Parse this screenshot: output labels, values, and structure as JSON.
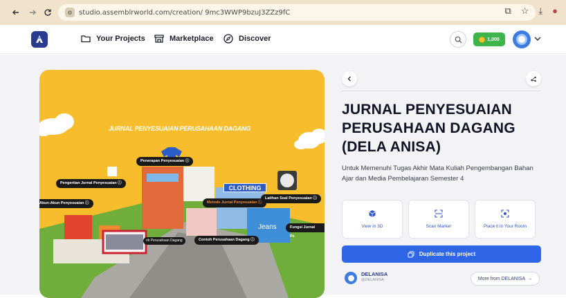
{
  "browser": {
    "url": "studio.assemblrworld.com/creation/ 9mc3WWP9bzuJ3ZZz9fC",
    "back_icon": "arrow-left-icon",
    "forward_icon": "arrow-right-icon",
    "reload_icon": "reload-icon"
  },
  "header": {
    "nav": [
      {
        "label": "Your Projects",
        "icon": "folder-icon"
      },
      {
        "label": "Marketplace",
        "icon": "store-icon"
      },
      {
        "label": "Discover",
        "icon": "compass-icon"
      }
    ],
    "coins": "1,000"
  },
  "scene": {
    "heading": "JURNAL PENYESUAIAN PERUSAHAAN DAGANG",
    "store_sign": "CLOTHING",
    "jeans_sign": "Jeans",
    "labels": [
      "Penerapan Penyesuaian",
      "Pengertian Jurnal Penyesuaian",
      "Akun-Akun Penyesuaian",
      "Metode Jurnal Penyesuaian",
      "Latihan Soal Penyesuaian",
      "Fungsi Jurnal Pe",
      "Contoh Perusahaan Dagang",
      "rik Perusahaan Dagang"
    ]
  },
  "panel": {
    "title": "JURNAL PENYESUAIAN PERUSAHAAN DAGANG (DELA ANISA)",
    "description": "Untuk Memenuhi Tugas Akhir Mata Kuliah Pengembangan Bahan Ajar dan Media Pembelajaran Semester 4",
    "actions": [
      {
        "label": "View in 3D",
        "icon": "cube-icon"
      },
      {
        "label": "Scan Marker",
        "icon": "scan-icon"
      },
      {
        "label": "Place it in Your Room",
        "icon": "ar-icon"
      }
    ],
    "duplicate_label": "Duplicate this project",
    "author": {
      "name": "DELANISA",
      "username": "@DELANISA"
    },
    "more_label": "More from DELANISA"
  },
  "colors": {
    "scene_bg": "#f7bd2c",
    "primary": "#2f66e8",
    "coins_bg": "#3db54a"
  }
}
